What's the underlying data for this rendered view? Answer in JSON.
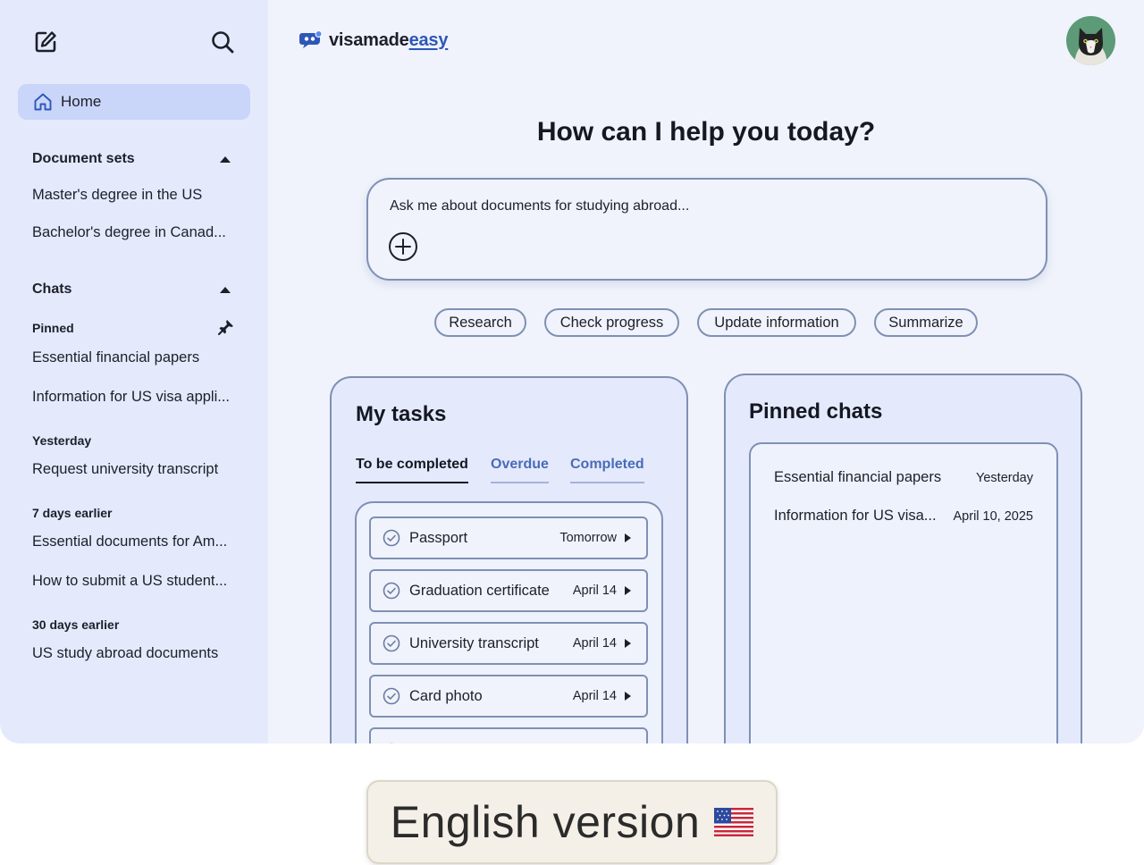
{
  "sidebar": {
    "home_label": "Home",
    "document_sets": {
      "title": "Document sets",
      "items": [
        "Master's degree in the US",
        "Bachelor's degree in Canad..."
      ]
    },
    "chats": {
      "title": "Chats",
      "groups": [
        {
          "label": "Pinned",
          "items": [
            "Essential financial papers",
            "Information for US visa appli..."
          ]
        },
        {
          "label": "Yesterday",
          "items": [
            "Request university transcript"
          ]
        },
        {
          "label": "7 days earlier",
          "items": [
            "Essential documents for Am...",
            "How to submit a US student..."
          ]
        },
        {
          "label": "30 days earlier",
          "items": [
            "US study abroad documents"
          ]
        }
      ]
    }
  },
  "header": {
    "logo_main": "visamade",
    "logo_accent": "easy"
  },
  "main": {
    "headline": "How can I help you today?",
    "ask_placeholder": "Ask me about documents for studying abroad...",
    "chips": [
      "Research",
      "Check progress",
      "Update information",
      "Summarize"
    ]
  },
  "tasks": {
    "title": "My tasks",
    "tabs": [
      "To be completed",
      "Overdue",
      "Completed"
    ],
    "active_tab": "To be completed",
    "items": [
      {
        "name": "Passport",
        "date": "Tomorrow"
      },
      {
        "name": "Graduation certificate",
        "date": "April 14"
      },
      {
        "name": "University transcript",
        "date": "April 14"
      },
      {
        "name": "Card photo",
        "date": "April 14"
      }
    ]
  },
  "pinned_chats": {
    "title": "Pinned chats",
    "items": [
      {
        "name": "Essential financial papers",
        "date": "Yesterday"
      },
      {
        "name": "Information for US visa...",
        "date": "April 10, 2025"
      }
    ]
  },
  "badge": {
    "text": "English version",
    "flag_icon": "us-flag-icon"
  },
  "colors": {
    "sidebar_bg": "#e4eafc",
    "active_item": "#c9d6fa",
    "border": "#7f90b5",
    "accent": "#2e56b8",
    "tab_inactive": "#4a6bb8"
  }
}
